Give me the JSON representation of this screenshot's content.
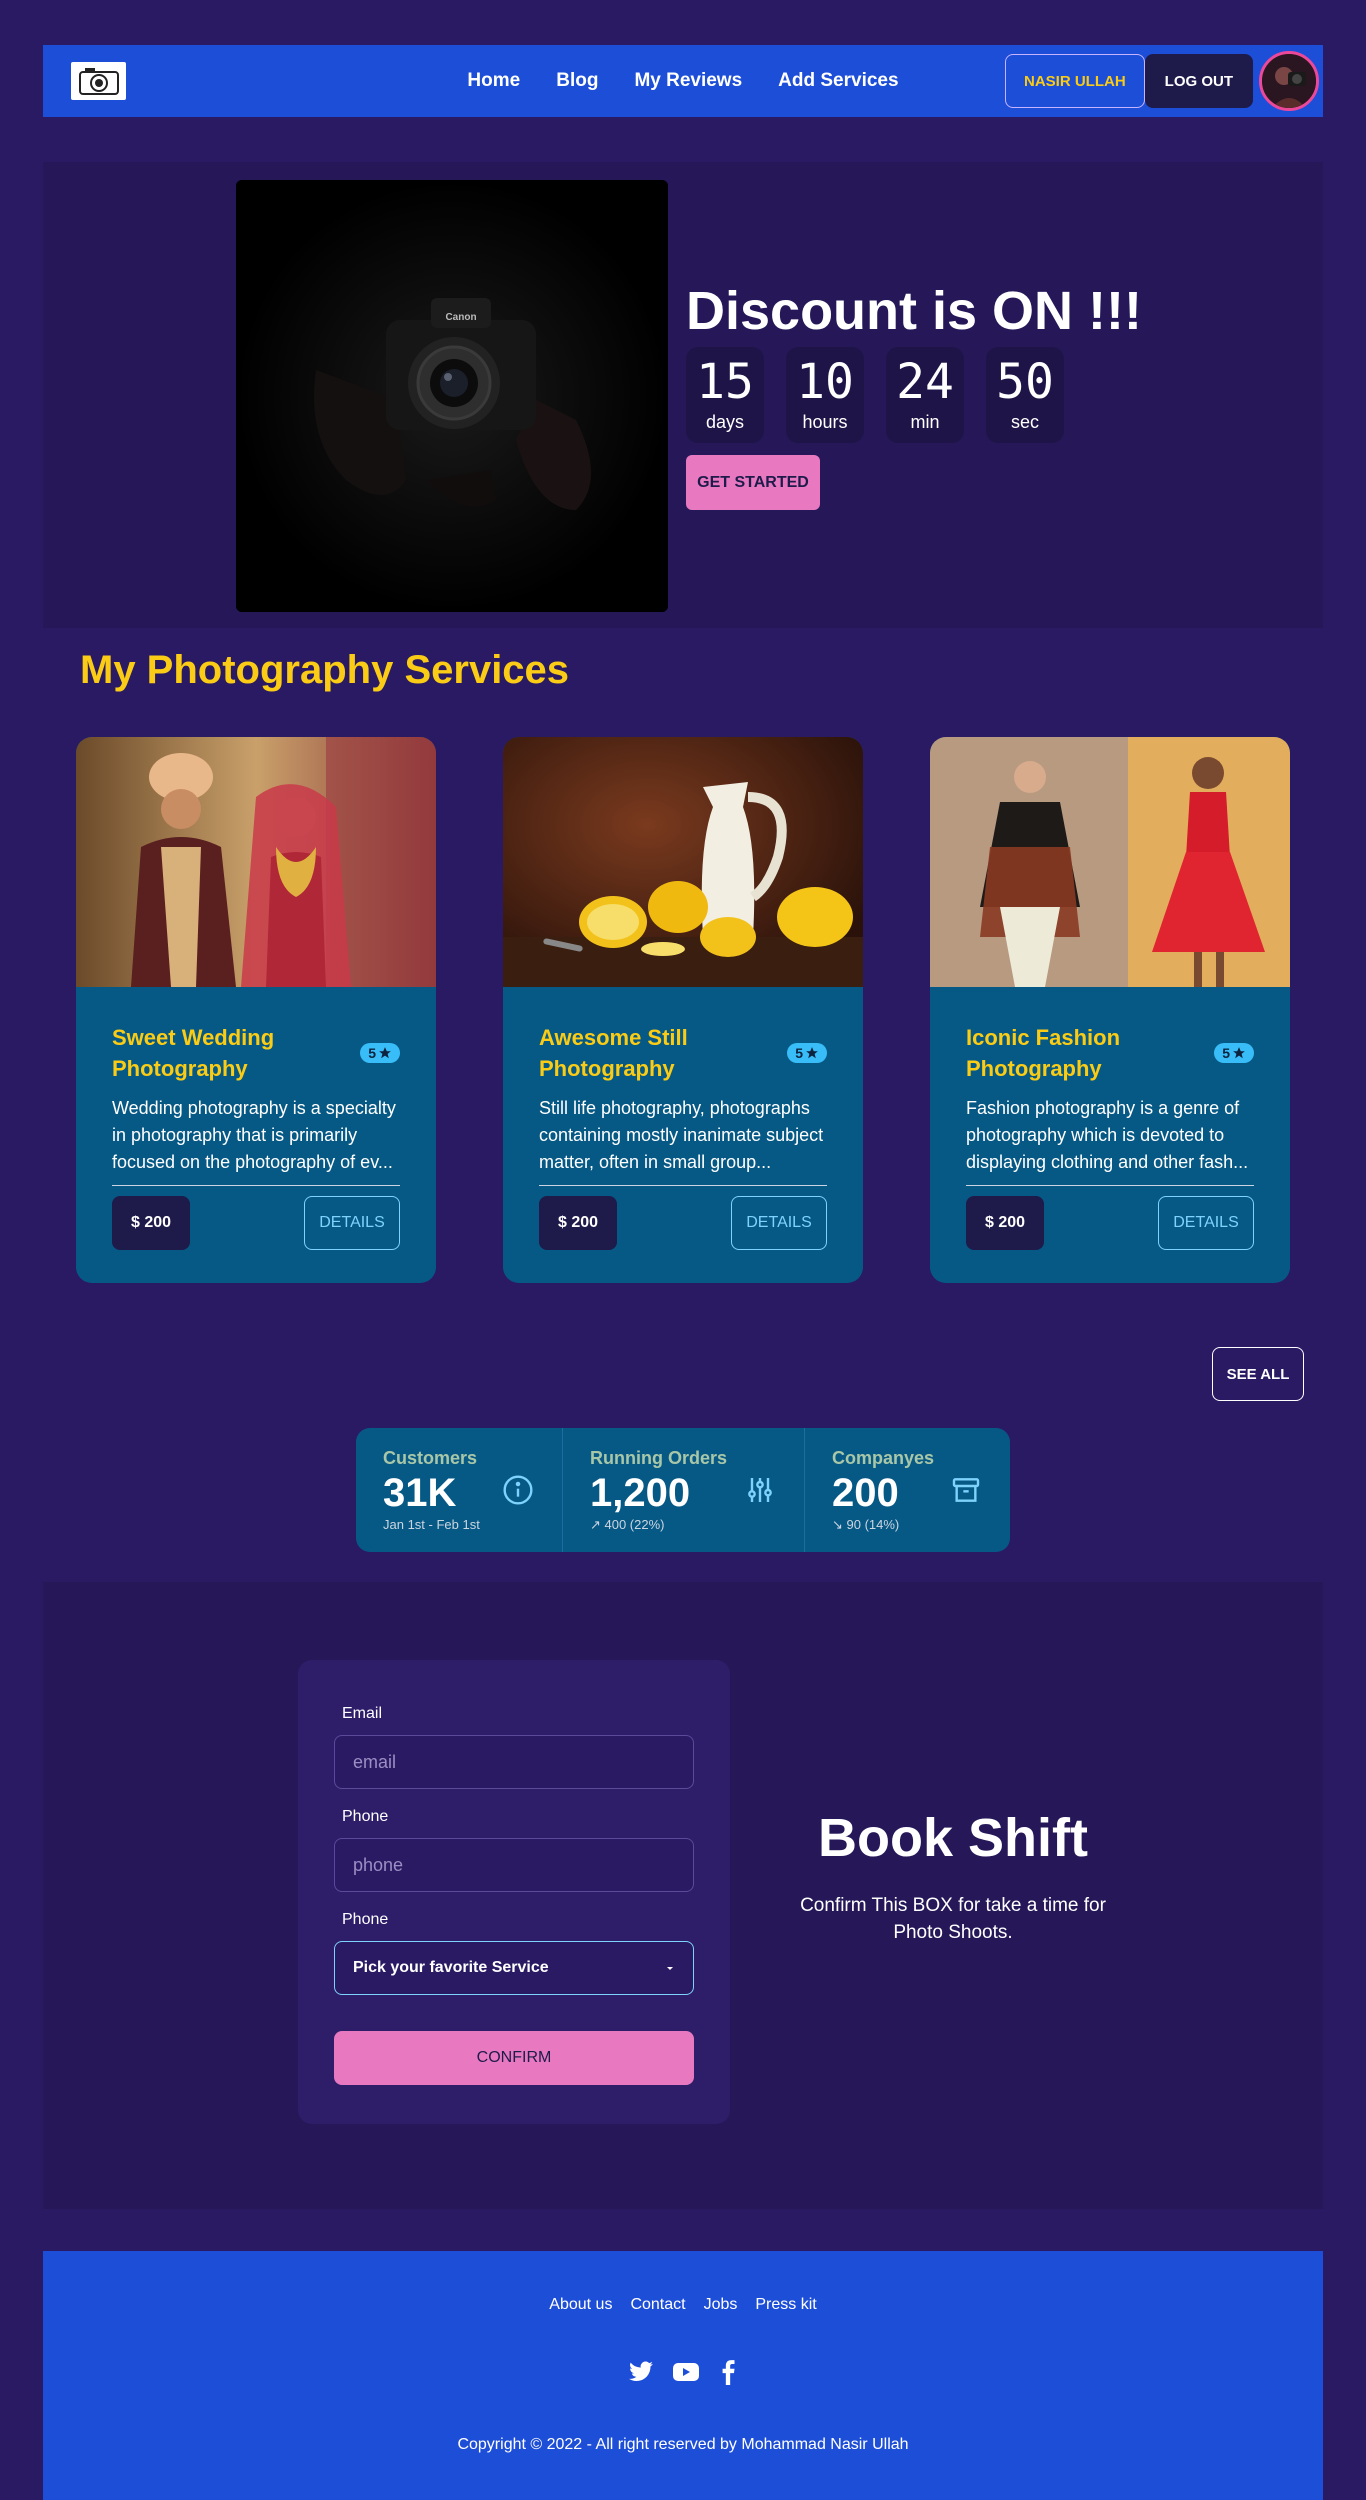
{
  "navbar": {
    "links": [
      "Home",
      "Blog",
      "My Reviews",
      "Add Services"
    ],
    "user_button": "NASIR ULLAH",
    "logout_button": "LOG OUT"
  },
  "hero": {
    "title": "Discount is ON !!!",
    "countdown": [
      {
        "value": "15",
        "label": "days"
      },
      {
        "value": "10",
        "label": "hours"
      },
      {
        "value": "24",
        "label": "min"
      },
      {
        "value": "50",
        "label": "sec"
      }
    ],
    "cta": "GET STARTED",
    "camera_brand": "Canon"
  },
  "services": {
    "title": "My Photography Services",
    "cards": [
      {
        "title": "Sweet Wedding Photography",
        "rating": "5",
        "description": "Wedding photography is a specialty in photography that is primarily focused on the photography of ev...",
        "price": "$ 200",
        "details_label": "DETAILS"
      },
      {
        "title": "Awesome Still Photography",
        "rating": "5",
        "description": "Still life photography, photographs containing mostly inanimate subject matter, often in small group...",
        "price": "$ 200",
        "details_label": "DETAILS"
      },
      {
        "title": "Iconic Fashion Photography",
        "rating": "5",
        "description": "Fashion photography is a genre of photography which is devoted to displaying clothing and other fash...",
        "price": "$ 200",
        "details_label": "DETAILS"
      }
    ],
    "see_all": "SEE ALL"
  },
  "stats": [
    {
      "title": "Customers",
      "value": "31K",
      "desc": "Jan 1st - Feb 1st",
      "icon": "info-icon"
    },
    {
      "title": "Running Orders",
      "value": "1,200",
      "desc": "↗︎ 400 (22%)",
      "icon": "sliders-icon"
    },
    {
      "title": "Companyes",
      "value": "200",
      "desc": "↘︎ 90 (14%)",
      "icon": "archive-icon"
    }
  ],
  "booking": {
    "email_label": "Email",
    "email_placeholder": "email",
    "phone_label": "Phone",
    "phone_placeholder": "phone",
    "service_label": "Phone",
    "service_selected": "Pick your favorite Service",
    "confirm": "CONFIRM",
    "title": "Book Shift",
    "description": "Confirm This BOX for take a time for Photo Shoots."
  },
  "footer": {
    "links": [
      "About us",
      "Contact",
      "Jobs",
      "Press kit"
    ],
    "copyright": "Copyright © 2022 - All right reserved by Mohammad Nasir Ullah"
  },
  "colors": {
    "background": "#2a1a63",
    "navbar": "#1d4ed8",
    "card": "#075985",
    "accent_yellow": "#facc15",
    "accent_pink": "#e879c1"
  }
}
